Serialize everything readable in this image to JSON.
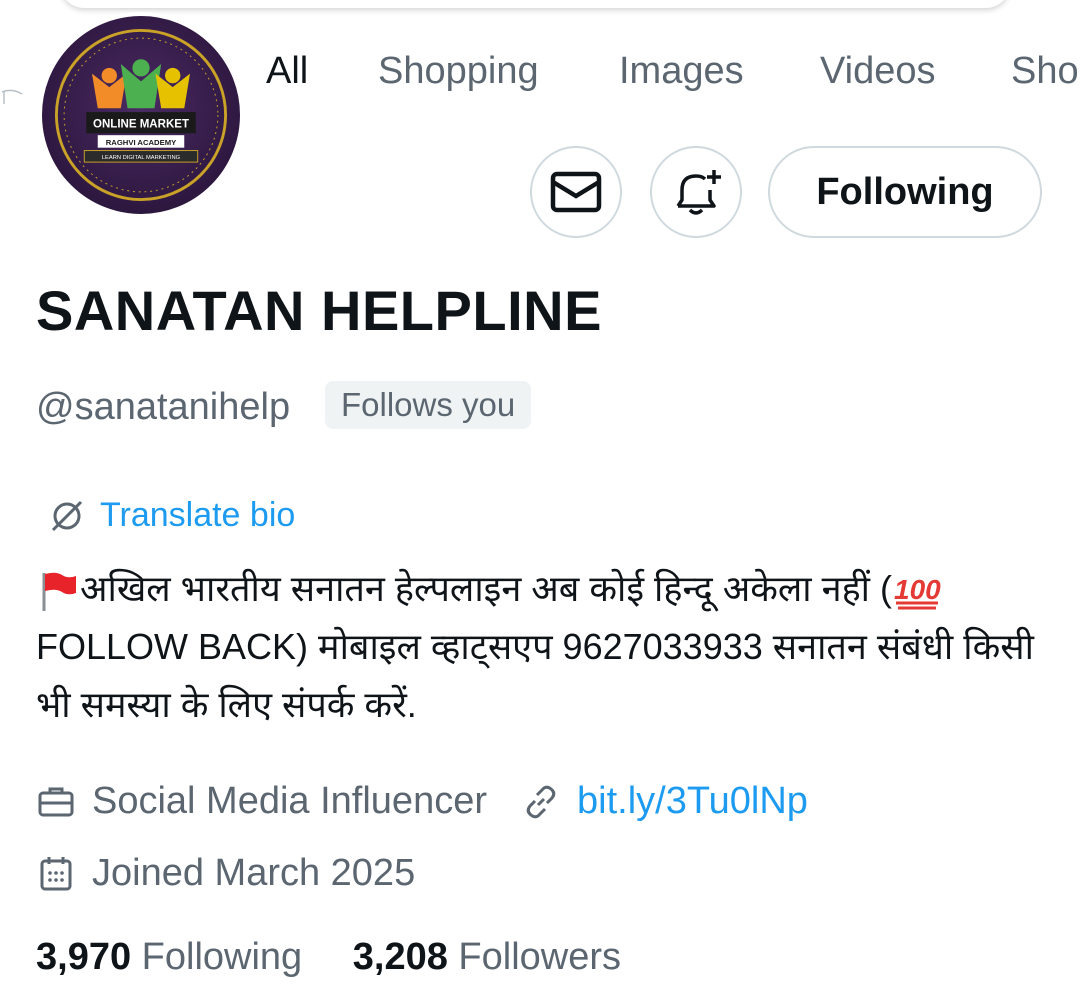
{
  "tabs": [
    "All",
    "Shopping",
    "Images",
    "Videos",
    "Sho"
  ],
  "avatar": {
    "line1": "ONLINE MARKET",
    "line2": "RAGHVI ACADEMY",
    "line3": "LEARN DIGITAL MARKETING"
  },
  "actions": {
    "message_icon": "envelope-icon",
    "notify_icon": "bell-plus-icon",
    "follow_label": "Following"
  },
  "profile": {
    "name": "SANATAN HELPLINE",
    "handle": "@sanatanihelp",
    "follows_you": "Follows you",
    "translate_label": "Translate bio",
    "bio_part1": "अखिल भारतीय सनातन हेल्पलाइन  अब कोई हिन्दू अकेला नहीं (",
    "bio_part2": "FOLLOW BACK) मोबाइल व्हाट्सएप 9627033933 सनातन संबंधी किसी भी समस्या के लिए संपर्क करें.",
    "category": "Social Media Influencer",
    "link": "bit.ly/3Tu0lNp",
    "joined": "Joined March 2025"
  },
  "stats": {
    "following_count": "3,970",
    "following_label": "Following",
    "followers_count": "3,208",
    "followers_label": "Followers"
  },
  "colors": {
    "link": "#1d9bf0",
    "secondary_text": "#5b6671",
    "primary_text": "#0f1419",
    "border": "#cfd9de"
  }
}
